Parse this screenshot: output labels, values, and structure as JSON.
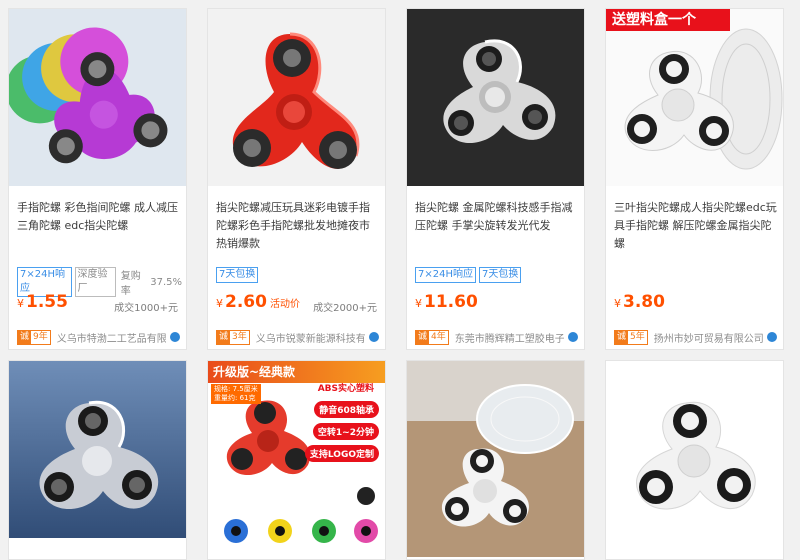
{
  "products": [
    {
      "title": "手指陀螺 彩色指间陀螺 成人减压 三角陀螺 edc指尖陀螺",
      "tags": [
        "7×24H响应",
        "深度验厂"
      ],
      "extra_label": "复购率",
      "extra_value": "37.5%",
      "price_currency": "¥",
      "price_value": "1.55",
      "price_note": "",
      "sold": "成交1000+元",
      "badge_main": "诚",
      "badge_years": "9年",
      "shop": "义乌市特渤二工艺品有限公司"
    },
    {
      "title": "指尖陀螺减压玩具迷彩电镀手指陀螺彩色手指陀螺批发地摊夜市热销爆款",
      "tags": [
        "7天包换"
      ],
      "extra_label": "",
      "extra_value": "",
      "price_currency": "¥",
      "price_value": "2.60",
      "price_note": "活动价",
      "sold": "成交2000+元",
      "badge_main": "诚",
      "badge_years": "3年",
      "shop": "义乌市锐蒙新能源科技有限公司"
    },
    {
      "title": "指尖陀螺 金属陀螺科技感手指减压陀螺 手掌尖旋转发光代发",
      "tags": [
        "7×24H响应",
        "7天包换"
      ],
      "extra_label": "",
      "extra_value": "",
      "price_currency": "¥",
      "price_value": "11.60",
      "price_note": "",
      "sold": "",
      "badge_main": "诚",
      "badge_years": "4年",
      "shop": "东莞市腾辉精工塑胶电子有限公司"
    },
    {
      "title": "三叶指尖陀螺成人指尖陀螺edc玩具手指陀螺 解压陀螺金属指尖陀螺",
      "tags": [],
      "extra_label": "",
      "extra_value": "",
      "price_currency": "¥",
      "price_value": "3.80",
      "price_note": "",
      "sold": "",
      "badge_main": "诚",
      "badge_years": "5年",
      "shop": "扬州市妙可贸易有限公司",
      "promo": "送塑料盒一个"
    },
    {
      "title": "",
      "note": "metallic spinner"
    },
    {
      "title": "",
      "upgrade": "升级版~经典款",
      "spec_lines": [
        "规格: 7.5厘米",
        "重量约: 61克"
      ],
      "features": [
        "ABS实心塑料",
        "静音608轴承",
        "空转1~2分钟",
        "支持LOGO定制"
      ]
    },
    {
      "title": "",
      "note": "spinner with box"
    },
    {
      "title": "",
      "note": "white spinner"
    }
  ],
  "colors": {
    "price": "#ff5000",
    "tag_blue": "#3a8ee6",
    "badge_orange": "#f27b1b",
    "promo_red": "#e8111b"
  }
}
